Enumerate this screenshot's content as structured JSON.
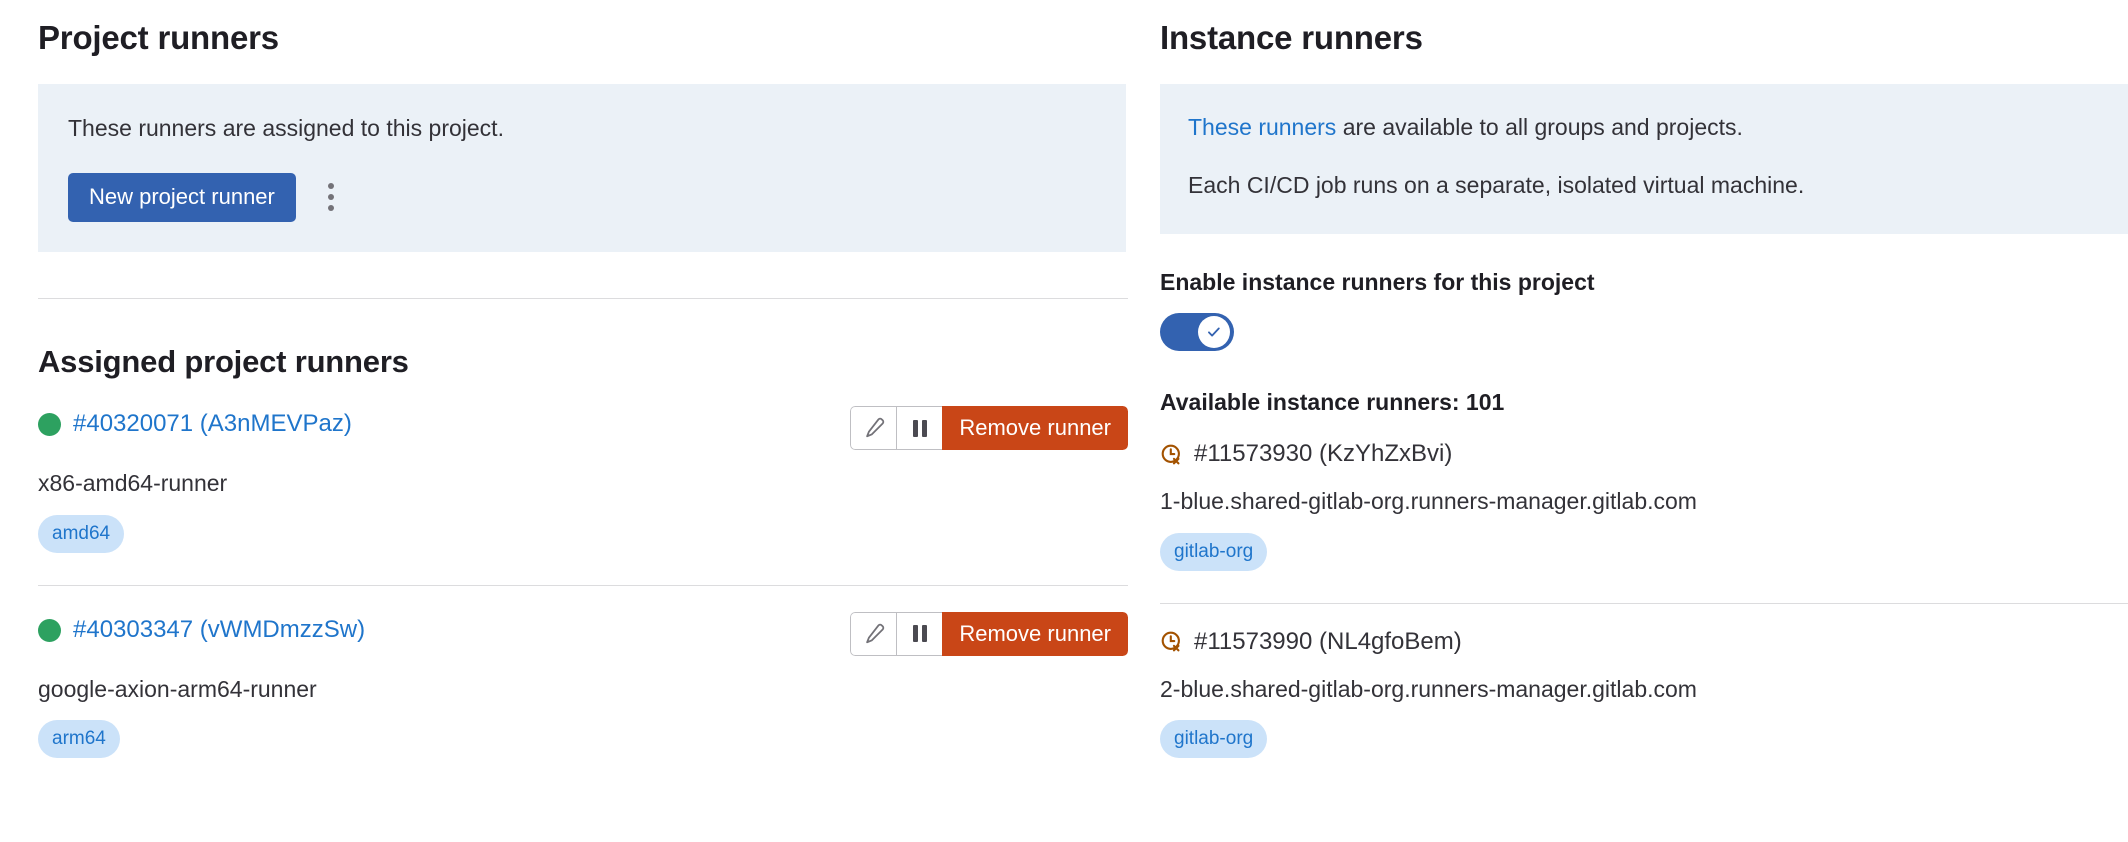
{
  "project_runners": {
    "title": "Project runners",
    "info": {
      "description": "These runners are assigned to this project."
    },
    "new_runner_button": "New project runner",
    "more_actions_icon": "kebab-menu-icon",
    "assigned_title": "Assigned project runners",
    "runners": [
      {
        "status": "online",
        "status_color": "#2da160",
        "link_label": "#40320071 (A3nMEVPaz)",
        "description": "x86-amd64-runner",
        "tags": [
          "amd64"
        ],
        "actions": {
          "edit_icon": "pencil-icon",
          "pause_icon": "pause-icon",
          "remove_label": "Remove runner"
        }
      },
      {
        "status": "online",
        "status_color": "#2da160",
        "link_label": "#40303347 (vWMDmzzSw)",
        "description": "google-axion-arm64-runner",
        "tags": [
          "arm64"
        ],
        "actions": {
          "edit_icon": "pencil-icon",
          "pause_icon": "pause-icon",
          "remove_label": "Remove runner"
        }
      }
    ]
  },
  "instance_runners": {
    "title": "Instance runners",
    "info": {
      "link_text": "These runners",
      "description_rest": " are available to all groups and projects.",
      "second_line": "Each CI/CD job runs on a separate, isolated virtual machine."
    },
    "toggle_label": "Enable instance runners for this project",
    "toggle_state": "on",
    "available_heading": "Available instance runners: 101",
    "runners": [
      {
        "status": "stale",
        "status_icon": "clock-x-icon",
        "status_color": "#a35200",
        "name": "#11573930 (KzYhZxBvi)",
        "description": "1-blue.shared-gitlab-org.runners-manager.gitlab.com",
        "tags": [
          "gitlab-org"
        ]
      },
      {
        "status": "stale",
        "status_icon": "clock-x-icon",
        "status_color": "#a35200",
        "name": "#11573990 (NL4gfoBem)",
        "description": "2-blue.shared-gitlab-org.runners-manager.gitlab.com",
        "tags": [
          "gitlab-org"
        ]
      }
    ]
  },
  "colors": {
    "primary_blue": "#3362b0",
    "link_blue": "#1f75cb",
    "danger_red": "#c94617",
    "panel_bg": "#ebf1f7",
    "tag_bg": "#cbe2f9",
    "online_green": "#2da160",
    "stale_orange": "#a35200"
  }
}
